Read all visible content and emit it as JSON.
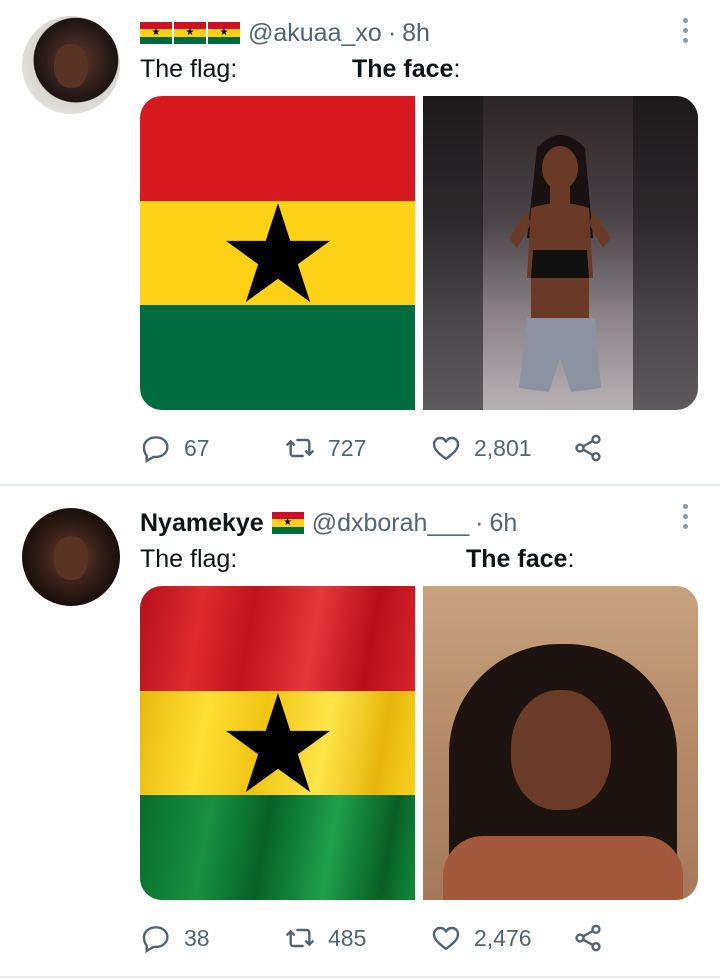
{
  "tweets": [
    {
      "flags": [
        "ghana-flag",
        "ghana-flag",
        "ghana-flag"
      ],
      "name": "",
      "handle": "@akuaa_xo",
      "separator": "·",
      "time": "8h",
      "text_left": "The flag:",
      "text_right_bold": "The face",
      "text_right_suffix": ":",
      "media": [
        "ghana-flag-flat",
        "photo-woman-standing"
      ],
      "actions": {
        "replies": "67",
        "retweets": "727",
        "likes": "2,801"
      }
    },
    {
      "flags": [
        "ghana-flag"
      ],
      "name": "Nyamekye",
      "handle": "@dxborah___",
      "separator": "·",
      "time": "6h",
      "text_left": "The flag:",
      "text_right_bold": "The face",
      "text_right_suffix": ":",
      "media": [
        "ghana-flag-wavy",
        "photo-woman-portrait"
      ],
      "actions": {
        "replies": "38",
        "retweets": "485",
        "likes": "2,476"
      }
    }
  ],
  "colors": {
    "flag_red": "#d71920",
    "flag_yellow": "#fcd116",
    "flag_green": "#006b3f",
    "muted_text": "#536471",
    "divider": "#e6ecf0"
  }
}
